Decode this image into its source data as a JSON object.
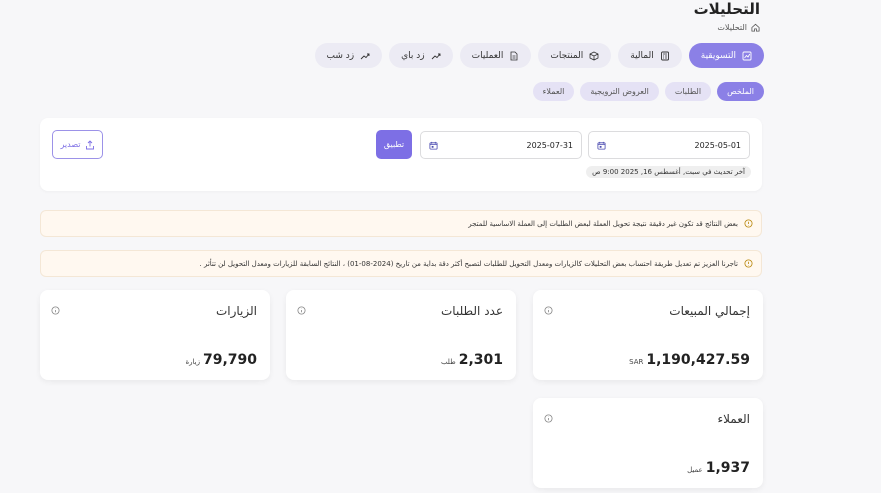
{
  "header": {
    "title": "التحليلات",
    "breadcrumb": "التحليلات"
  },
  "tabs": [
    {
      "label": "التسويقية",
      "icon": "chart-line-icon",
      "active": true
    },
    {
      "label": "المالية",
      "icon": "calculator-icon",
      "active": false
    },
    {
      "label": "المنتجات",
      "icon": "box-icon",
      "active": false
    },
    {
      "label": "العمليات",
      "icon": "document-icon",
      "active": false
    },
    {
      "label": "زد باي",
      "icon": "trend-icon",
      "active": false
    },
    {
      "label": "زد شب",
      "icon": "trend-icon",
      "active": false
    }
  ],
  "subtabs": [
    {
      "label": "الملخص",
      "active": true
    },
    {
      "label": "الطلبات",
      "active": false
    },
    {
      "label": "العروض الترويجية",
      "active": false
    },
    {
      "label": "العملاء",
      "active": false
    }
  ],
  "filter": {
    "date_from": "2025-05-01",
    "date_to": "2025-07-31",
    "apply_label": "تطبيق",
    "export_label": "تصدير",
    "last_update": "آخر تحديث في سبت, أغسطس 16, 2025 9:00 ص"
  },
  "notices": [
    "بعض النتائج قد تكون غير دقيقة نتيجة تحويل العملة لبعض الطلبات إلى العملة الاساسية للمتجر",
    "تاجرنا العزيز تم تعديل طريقة احتساب بعض التحليلات كالزيارات ومعدل التحويل للطلبات لتصبح أكثر دقة بداية من تاريخ (2024-08-01) ، النتائج السابقة للزيارات ومعدل التحويل لن تتأثر ."
  ],
  "kpis": {
    "sales": {
      "title": "إجمالي المبيعات",
      "value": "1,190,427.59",
      "unit": "SAR"
    },
    "orders": {
      "title": "عدد الطلبات",
      "value": "2,301",
      "unit": "طلب"
    },
    "visits": {
      "title": "الزيارات",
      "value": "79,790",
      "unit": "زيارة"
    },
    "customers": {
      "title": "العملاء",
      "value": "1,937",
      "unit": "عميل"
    }
  },
  "colors": {
    "accent": "#8b80e6",
    "notice_bg": "#fff8f0",
    "page_bg": "#f7f7f9"
  }
}
